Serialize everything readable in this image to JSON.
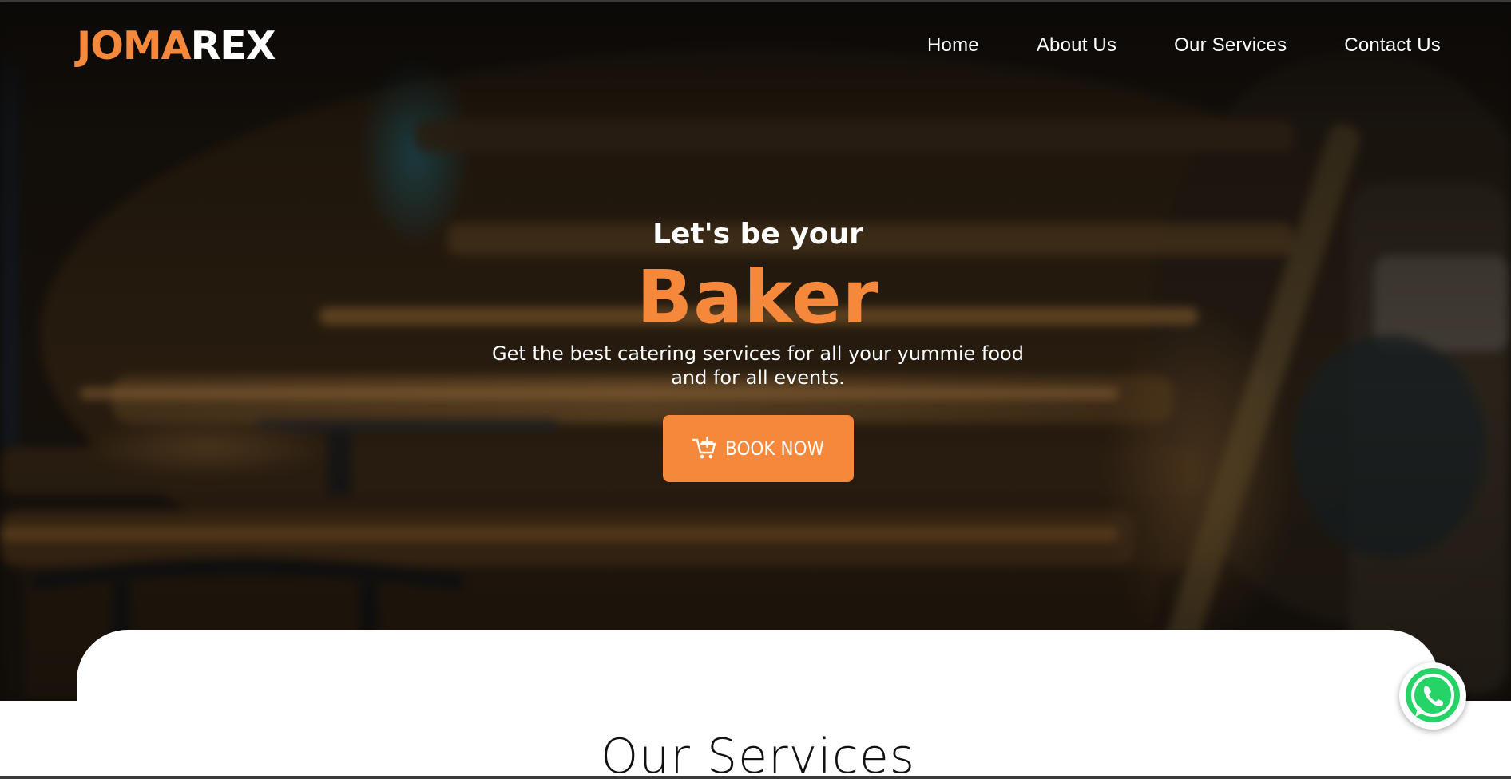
{
  "brand": {
    "logo_accent": "JOMA",
    "logo_rest": "REX",
    "accent_color": "#f5883a"
  },
  "nav": {
    "items": [
      {
        "label": "Home"
      },
      {
        "label": "About Us"
      },
      {
        "label": "Our Services"
      },
      {
        "label": "Contact Us"
      }
    ]
  },
  "hero": {
    "pretitle": "Let's be your",
    "title": "Baker",
    "description": "Get the best catering services for all your yummie food and for all events.",
    "cta": {
      "label": "BOOK NOW",
      "icon": "cart-plus-icon"
    }
  },
  "services": {
    "heading": "Our Services"
  },
  "floating": {
    "whatsapp_icon": "whatsapp-icon",
    "whatsapp_color": "#25d366"
  }
}
